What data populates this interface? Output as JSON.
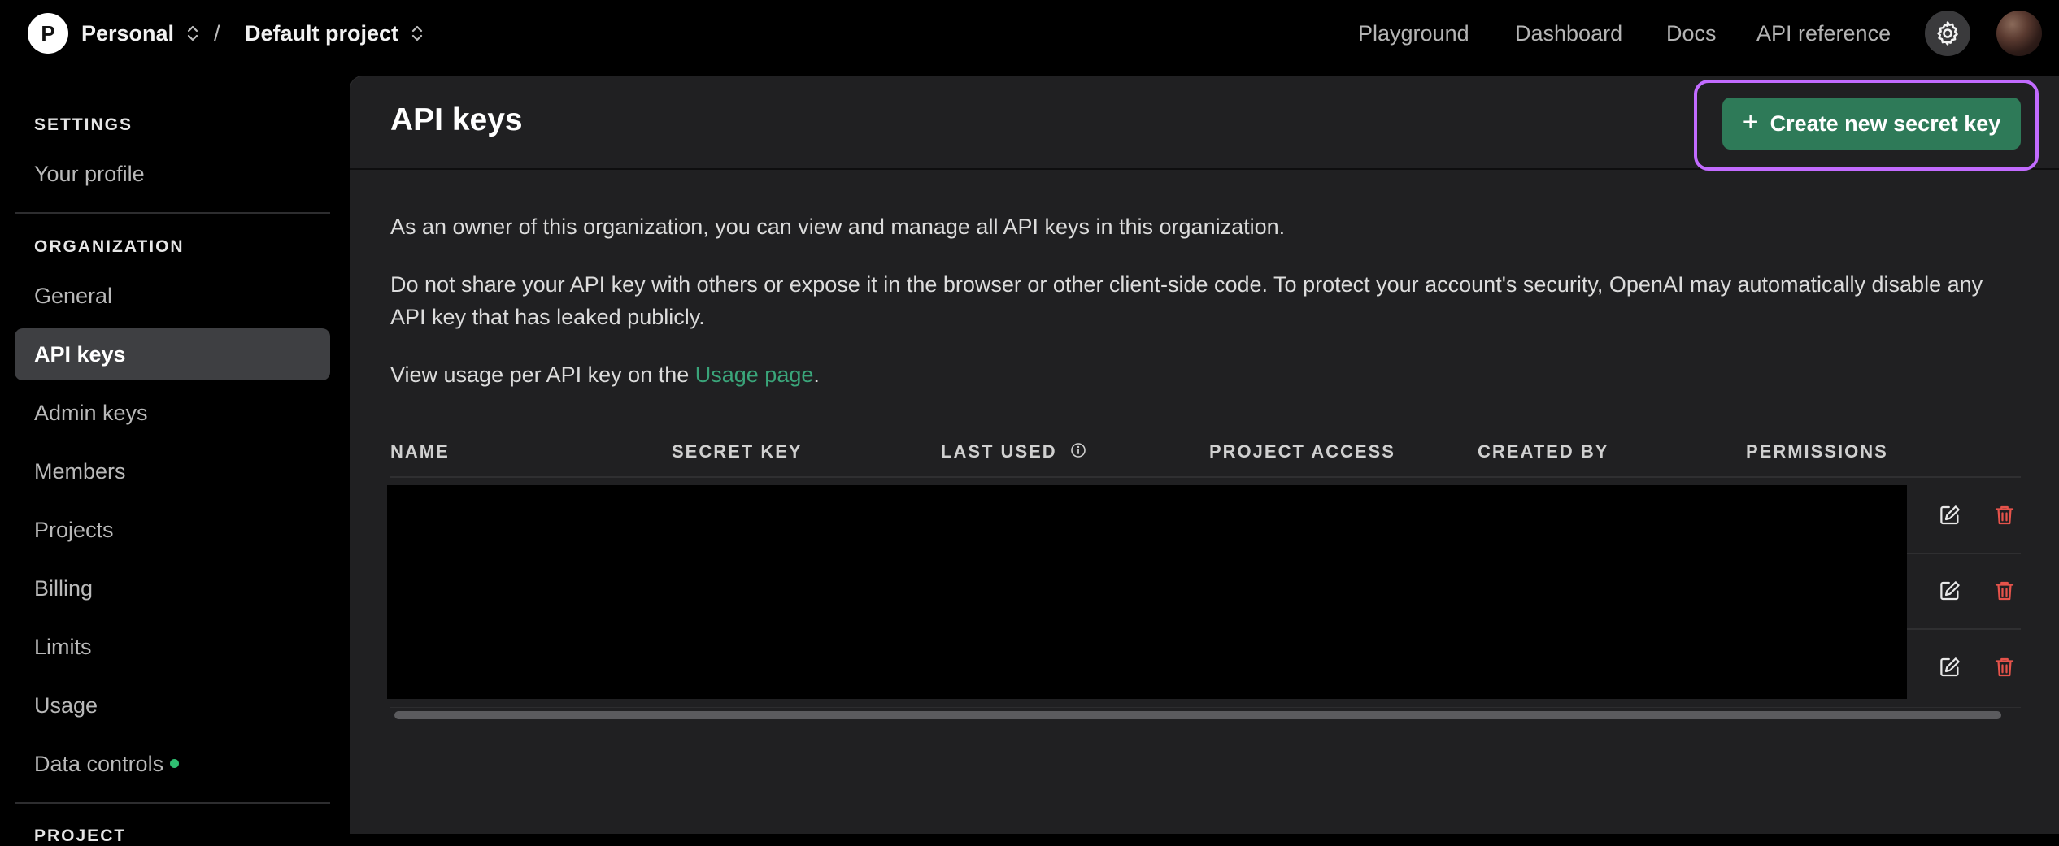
{
  "topbar": {
    "org_initial": "P",
    "org_name": "Personal",
    "separator": "/",
    "project_name": "Default project",
    "nav": [
      "Playground",
      "Dashboard",
      "Docs",
      "API reference"
    ],
    "settings_icon": "gear-icon"
  },
  "sidebar": {
    "settings_heading": "SETTINGS",
    "your_profile": "Your profile",
    "organization_heading": "ORGANIZATION",
    "org_items": [
      "General",
      "API keys",
      "Admin keys",
      "Members",
      "Projects",
      "Billing",
      "Limits",
      "Usage",
      "Data controls"
    ],
    "active_item": "API keys",
    "project_heading": "PROJECT"
  },
  "main": {
    "title": "API keys",
    "create_button": "Create new secret key",
    "intro": "As an owner of this organization, you can view and manage all API keys in this organization.",
    "warning": "Do not share your API key with others or expose it in the browser or other client-side code. To protect your account's security, OpenAI may automatically disable any API key that has leaked publicly.",
    "usage_prefix": "View usage per API key on the ",
    "usage_link": "Usage page",
    "usage_suffix": ".",
    "table": {
      "headers": [
        "NAME",
        "SECRET KEY",
        "LAST USED",
        "PROJECT ACCESS",
        "CREATED BY",
        "PERMISSIONS"
      ],
      "row_count": 3
    }
  },
  "colors": {
    "accent_green": "#2e7a58",
    "link_green": "#3aa57a",
    "highlight_purple": "#c26bff",
    "delete_red": "#e5534b",
    "status_dot": "#2fbf71"
  }
}
